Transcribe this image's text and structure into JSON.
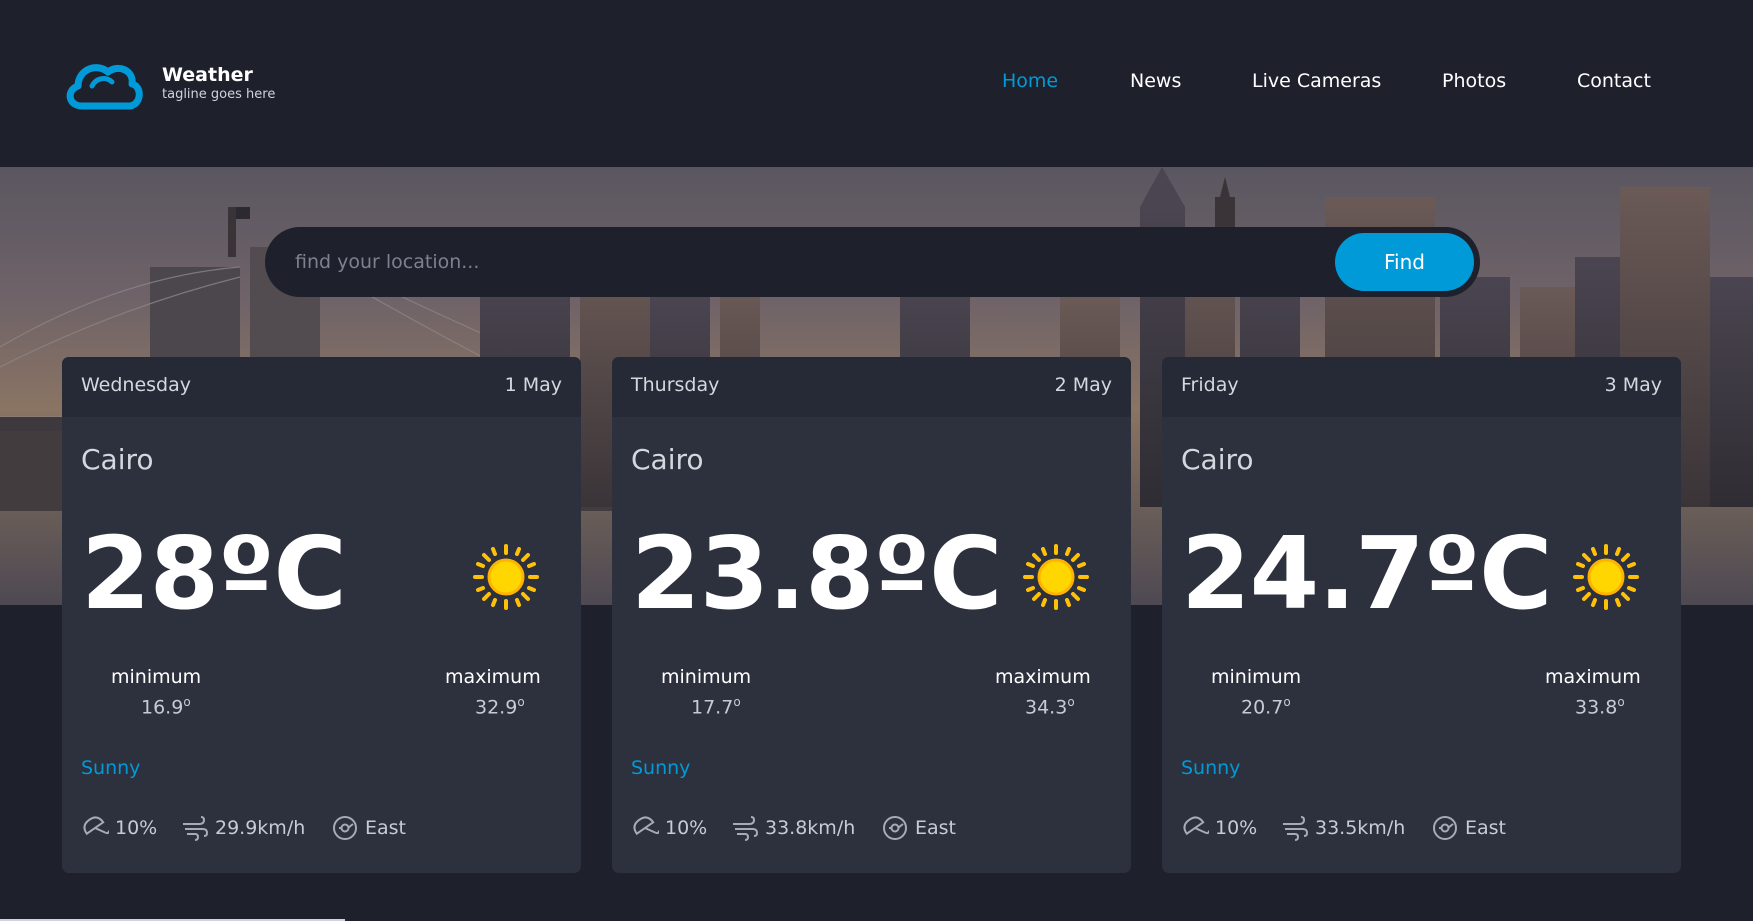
{
  "brand": {
    "title": "Weather",
    "tagline": "tagline goes here"
  },
  "nav": {
    "items": [
      {
        "label": "Home",
        "active": true
      },
      {
        "label": "News",
        "active": false
      },
      {
        "label": "Live Cameras",
        "active": false
      },
      {
        "label": "Photos",
        "active": false
      },
      {
        "label": "Contact",
        "active": false
      }
    ]
  },
  "search": {
    "placeholder": "find your location...",
    "value": "",
    "button_label": "Find"
  },
  "forecast": [
    {
      "day": "Wednesday",
      "date": "1 May",
      "city": "Cairo",
      "temp": "28ºC",
      "icon": "sun-icon",
      "min_label": "minimum",
      "min_value": "16.9",
      "max_label": "maximum",
      "max_value": "32.9",
      "condition": "Sunny",
      "rain": "10%",
      "wind": "29.9km/h",
      "direction": "East"
    },
    {
      "day": "Thursday",
      "date": "2 May",
      "city": "Cairo",
      "temp": "23.8ºC",
      "icon": "sun-icon",
      "min_label": "minimum",
      "min_value": "17.7",
      "max_label": "maximum",
      "max_value": "34.3",
      "condition": "Sunny",
      "rain": "10%",
      "wind": "33.8km/h",
      "direction": "East"
    },
    {
      "day": "Friday",
      "date": "3 May",
      "city": "Cairo",
      "temp": "24.7ºC",
      "icon": "sun-icon",
      "min_label": "minimum",
      "min_value": "20.7",
      "max_label": "maximum",
      "max_value": "33.8",
      "condition": "Sunny",
      "rain": "10%",
      "wind": "33.5km/h",
      "direction": "East"
    }
  ],
  "degree_symbol": "o",
  "colors": {
    "background": "#1e202b",
    "card": "#2d303d",
    "card_header": "#262936",
    "accent": "#009ad8",
    "sun": "#ffc107"
  }
}
